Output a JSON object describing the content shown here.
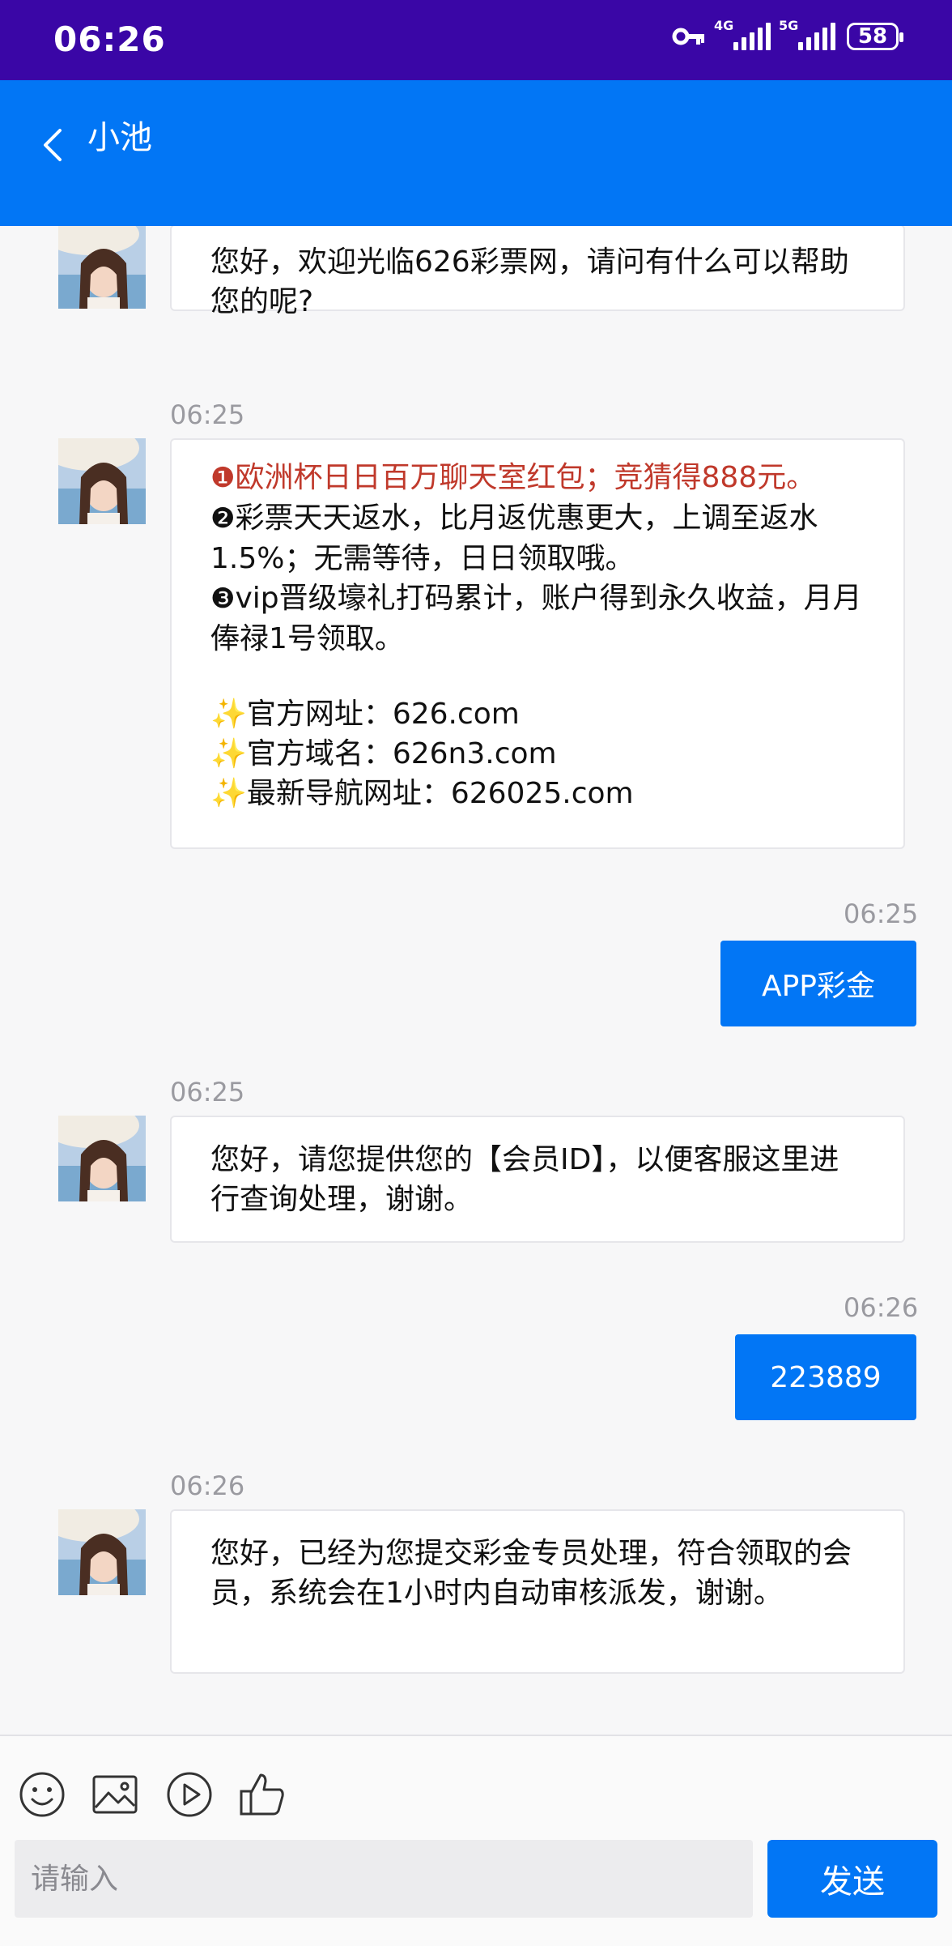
{
  "status_bar": {
    "time": "06:26",
    "net1": "4G",
    "net2": "5G",
    "battery": "58"
  },
  "header": {
    "title": "小池"
  },
  "messages": {
    "m1": {
      "text": "您好，欢迎光临626彩票网，请问有什么可以帮助您的呢?"
    },
    "m2": {
      "time": "06:25",
      "l1_marker": "❶",
      "l1": "欧洲杯日日百万聊天室红包；竞猜得888元。",
      "l2_marker": "❷",
      "l2": "彩票天天返水，比月返优惠更大，上调至返水1.5%；无需等待，日日领取哦。",
      "l3_marker": "❸",
      "l3": "vip晋级壕礼打码累计，账户得到永久收益，月月俸禄1号领取。",
      "sparkle": "✨",
      "l4": "官方网址：626.com",
      "l5": "官方域名：626n3.com",
      "l6": "最新导航网址：626025.com"
    },
    "m3": {
      "time": "06:25",
      "text": "APP彩金"
    },
    "m4": {
      "time": "06:25",
      "text": "您好，请您提供您的【会员ID】，以便客服这里进行查询处理，谢谢。"
    },
    "m5": {
      "time": "06:26",
      "text": "223889"
    },
    "m6": {
      "time": "06:26",
      "text": "您好，已经为您提交彩金专员处理，符合领取的会员，系统会在1小时内自动审核派发，谢谢。"
    }
  },
  "input_bar": {
    "placeholder": "请输入",
    "send_label": "发送",
    "icons": [
      "emoji-icon",
      "image-icon",
      "video-icon",
      "thumbs-up-icon"
    ]
  },
  "colors": {
    "status_bar": "#3a06a6",
    "accent": "#0276f5",
    "highlight_text": "#c0392b"
  }
}
